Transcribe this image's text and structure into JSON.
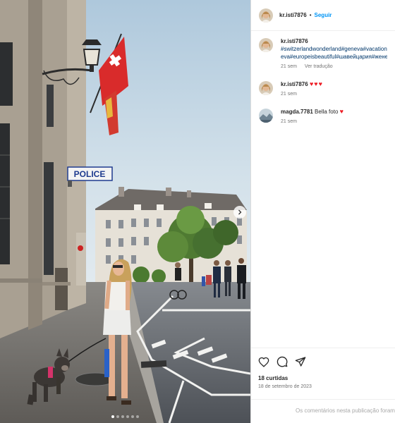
{
  "post": {
    "username": "kr.isti7876",
    "separator": "•",
    "follow_label": "Seguir",
    "police_sign": "POLICE",
    "carousel": {
      "slide_count": 6,
      "active_index": 0
    }
  },
  "comments": [
    {
      "username": "kr.isti7876",
      "hashtags_line1": "#switzerlandwonderland#geneva#vacation",
      "hashtags_line2": "eva#europeisbeautiful#шавейцария#жене",
      "time": "21 sem",
      "translate_label": "Ver tradução",
      "avatar": "woman-photo"
    },
    {
      "username": "kr.isti7876",
      "text": "♥♥♥",
      "time": "21 sem",
      "avatar": "woman-photo"
    },
    {
      "username": "magda.7781",
      "text": "Bella foto",
      "emoji": "♥",
      "time": "21 sem",
      "avatar": "landscape-photo"
    }
  ],
  "actions": {
    "like_icon": "heart-outline-icon",
    "comment_icon": "comment-bubble-icon",
    "share_icon": "paper-plane-icon",
    "likes": "18 curtidas",
    "date": "18 de setembro de 2023"
  },
  "footer": {
    "text": "Os comentários nesta publicação foram limitados."
  },
  "colors": {
    "link": "#0095f6",
    "hashtag": "#00376b",
    "heart": "#ed1c24",
    "muted": "#737373"
  }
}
